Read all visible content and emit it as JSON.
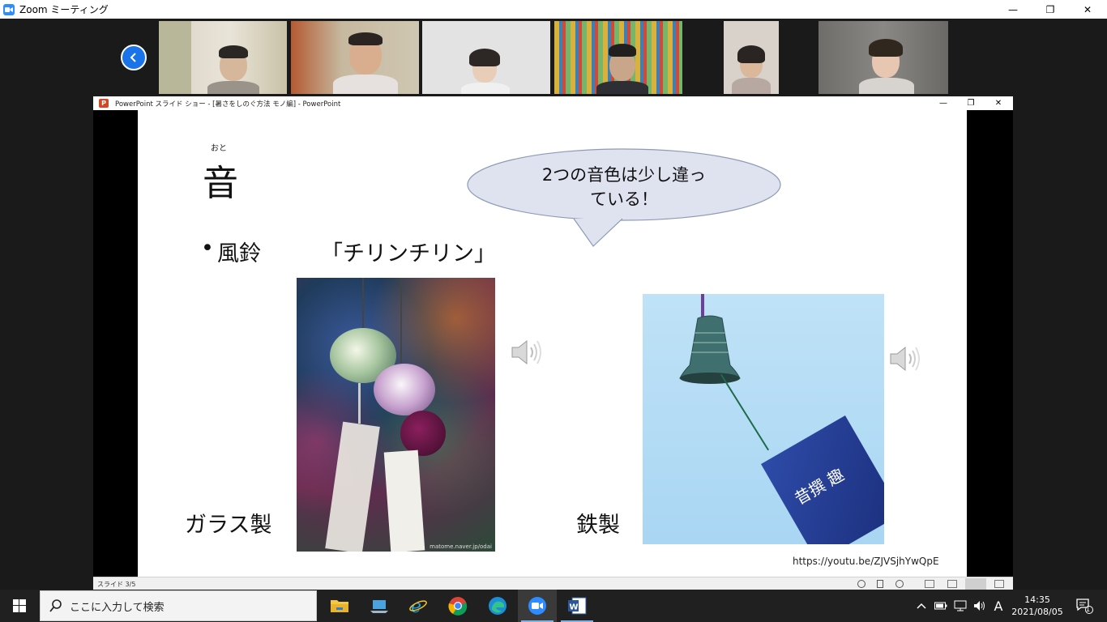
{
  "zoom": {
    "window_title": "Zoom ミーティング",
    "controls": {
      "minimize": "—",
      "restore": "❐",
      "close": "✕"
    }
  },
  "meeting": {
    "participants_count": 6,
    "prev_icon": "chevron-left-icon"
  },
  "powerpoint": {
    "window_title": "PowerPoint スライド ショー - [暑さをしのぐ方法 モノ編] - PowerPoint",
    "controls": {
      "minimize": "—",
      "restore": "❐",
      "close": "✕"
    },
    "status": {
      "slide_info": "スライド 3/5"
    }
  },
  "slide": {
    "ruby": "おと",
    "heading": "音",
    "bullet": "•",
    "bullet_label": "風鈴",
    "onomatopoeia": "「チリンチリン」",
    "callout_line1": "2つの音色は少し違っ",
    "callout_line2": "ている！",
    "left_caption": "ガラス製",
    "right_caption": "鉄製",
    "image_credit": "matome.naver.jp/odai",
    "bell_text": "昔撰 趣",
    "url": "https://youtu.be/ZJVSjhYwQpE"
  },
  "taskbar": {
    "search_placeholder": "ここに入力して検索",
    "ime": "A",
    "time": "14:35",
    "date": "2021/08/05",
    "notification_count": "1"
  },
  "colors": {
    "zoom_blue": "#2d8cff",
    "callout_fill": "#dfe3f0",
    "callout_stroke": "#8e9ab6",
    "ppt_red": "#d24726"
  }
}
